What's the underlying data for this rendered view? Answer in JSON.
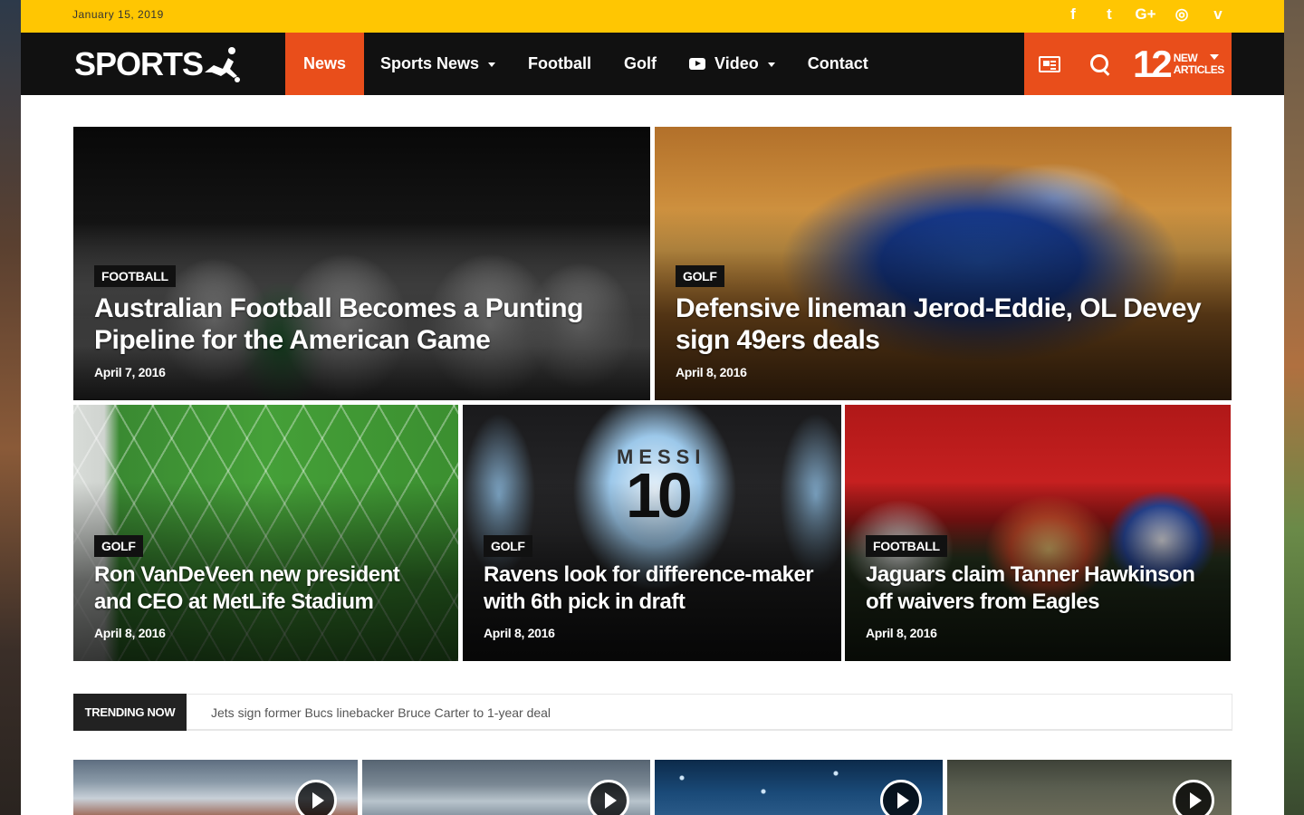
{
  "topbar": {
    "date": "January 15, 2019",
    "socials": [
      {
        "icon": "facebook-icon",
        "glyph": "f"
      },
      {
        "icon": "twitter-icon",
        "glyph": "t"
      },
      {
        "icon": "google-plus-icon",
        "glyph": "G+"
      },
      {
        "icon": "dribbble-icon",
        "glyph": "◎"
      },
      {
        "icon": "vimeo-icon",
        "glyph": "v"
      }
    ]
  },
  "nav": {
    "logo": "SPORTS",
    "items": [
      {
        "label": "News",
        "active": true
      },
      {
        "label": "Sports News",
        "dropdown": true
      },
      {
        "label": "Football"
      },
      {
        "label": "Golf"
      },
      {
        "label": "Video",
        "dropdown": true,
        "icon": "video-icon"
      },
      {
        "label": "Contact"
      }
    ],
    "new_articles_count": "12",
    "new_articles_label_1": "NEW",
    "new_articles_label_2": "ARTICLES"
  },
  "featured": [
    {
      "category": "FOOTBALL",
      "title": "Australian Football Becomes a Punting Pipeline for the American Game",
      "date": "April 7, 2016"
    },
    {
      "category": "GOLF",
      "title": "Defensive lineman Jerod-Eddie, OL Devey sign 49ers deals",
      "date": "April 8, 2016"
    },
    {
      "category": "GOLF",
      "title": "Ron VanDeVeen new president and CEO at MetLife Stadium",
      "date": "April 8, 2016"
    },
    {
      "category": "GOLF",
      "title": "Ravens look for difference-maker with 6th pick in draft",
      "date": "April 8, 2016"
    },
    {
      "category": "FOOTBALL",
      "title": "Jaguars claim Tanner Hawkinson off waivers from Eagles",
      "date": "April 8, 2016"
    }
  ],
  "jersey": {
    "name": "MESSI",
    "number": "10"
  },
  "trending": {
    "label": "TRENDING NOW",
    "text": "Jets sign former Bucs linebacker Bruce Carter to 1-year deal"
  },
  "colors": {
    "accent": "#e94e1b",
    "topbar": "#ffc602",
    "nav": "#111111"
  }
}
